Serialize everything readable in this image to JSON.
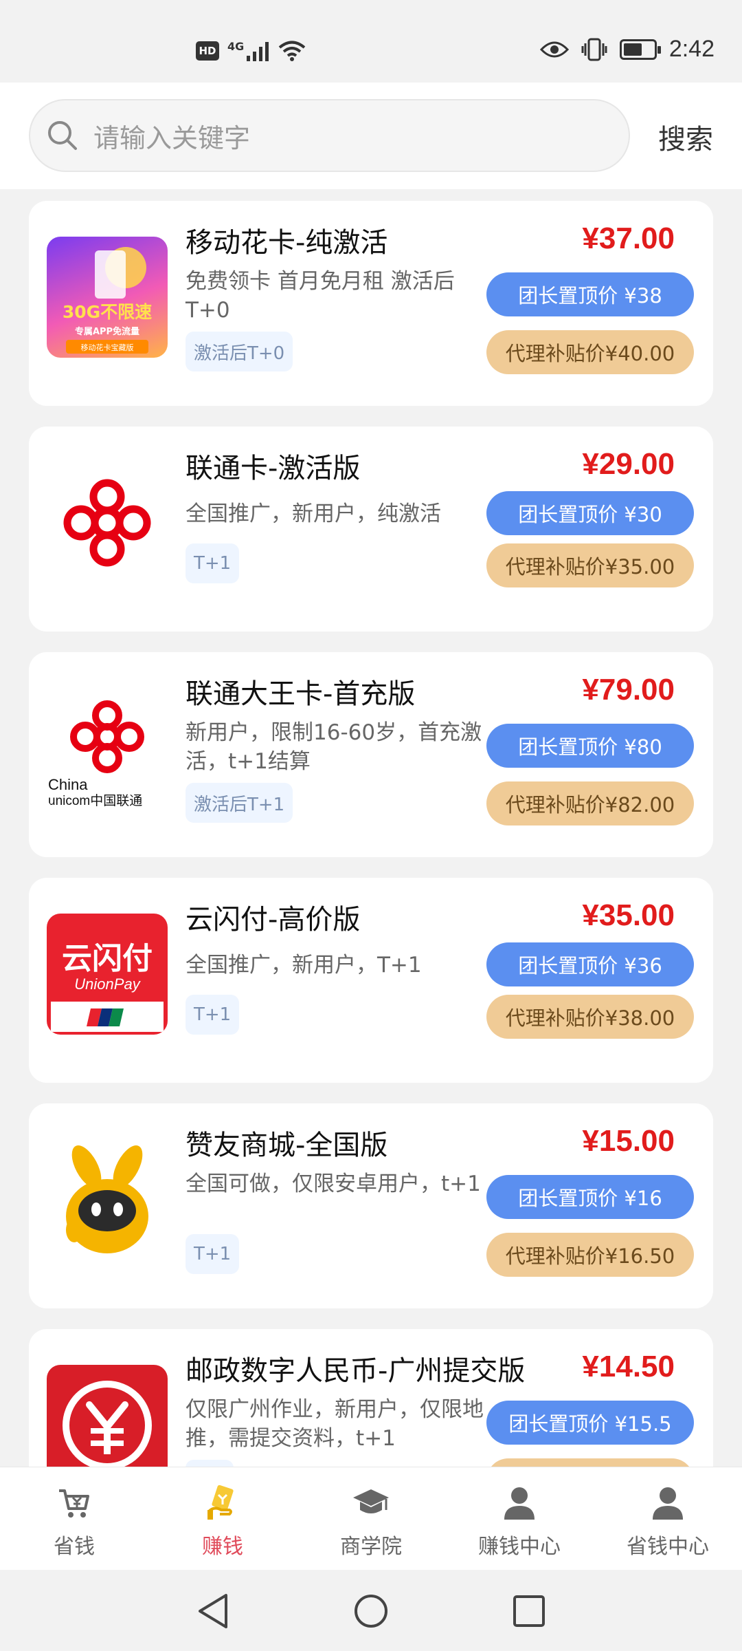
{
  "status_bar": {
    "network": "4G",
    "hd": "HD",
    "time": "2:42"
  },
  "search": {
    "placeholder": "请输入关键字",
    "button_label": "搜索"
  },
  "products": [
    {
      "title": "移动花卡-纯激活",
      "description": "免费领卡  首月免月租  激活后T+0",
      "tag": "激活后T+0",
      "price": "¥37.00",
      "leader_price": "团长置顶价 ¥38",
      "agent_price": "代理补贴价¥40.00",
      "thumb_text": [
        "30G不限速",
        "专属APP免流量",
        "移动花卡宝藏版"
      ]
    },
    {
      "title": "联通卡-激活版",
      "description": "全国推广，新用户，纯激活",
      "tag": "T+1",
      "price": "¥29.00",
      "leader_price": "团长置顶价 ¥30",
      "agent_price": "代理补贴价¥35.00"
    },
    {
      "title": "联通大王卡-首充版",
      "description": "新用户，限制16-60岁，首充激活，t+1结算",
      "tag": "激活后T+1",
      "price": "¥79.00",
      "leader_price": "团长置顶价 ¥80",
      "agent_price": "代理补贴价¥82.00",
      "thumb_text": [
        "China",
        "unicom中国联通"
      ]
    },
    {
      "title": "云闪付-高价版",
      "description": "全国推广，新用户，T+1",
      "tag": "T+1",
      "price": "¥35.00",
      "leader_price": "团长置顶价 ¥36",
      "agent_price": "代理补贴价¥38.00",
      "thumb_text": [
        "云闪付",
        "UnionPay"
      ]
    },
    {
      "title": "赞友商城-全国版",
      "description": "全国可做，仅限安卓用户，t+1",
      "tag": "T+1",
      "price": "¥15.00",
      "leader_price": "团长置顶价 ¥16",
      "agent_price": "代理补贴价¥16.50"
    },
    {
      "title": "邮政数字人民币-广州提交版",
      "description": "仅限广州作业，新用户，仅限地推，需提交资料，t+1",
      "tag": "",
      "price": "¥14.50",
      "leader_price": "团长置顶价 ¥15.5",
      "agent_price": ""
    }
  ],
  "tabs": [
    {
      "label": "省钱",
      "icon": "cart-icon"
    },
    {
      "label": "赚钱",
      "icon": "earn-icon",
      "active": true
    },
    {
      "label": "商学院",
      "icon": "graduation-cap-icon"
    },
    {
      "label": "赚钱中心",
      "icon": "user-icon"
    },
    {
      "label": "省钱中心",
      "icon": "user-icon"
    }
  ],
  "colors": {
    "price": "#e11c1c",
    "leader_button": "#5b8ff0",
    "agent_button": "#f0cb96",
    "active_tab": "#e04a5a"
  }
}
